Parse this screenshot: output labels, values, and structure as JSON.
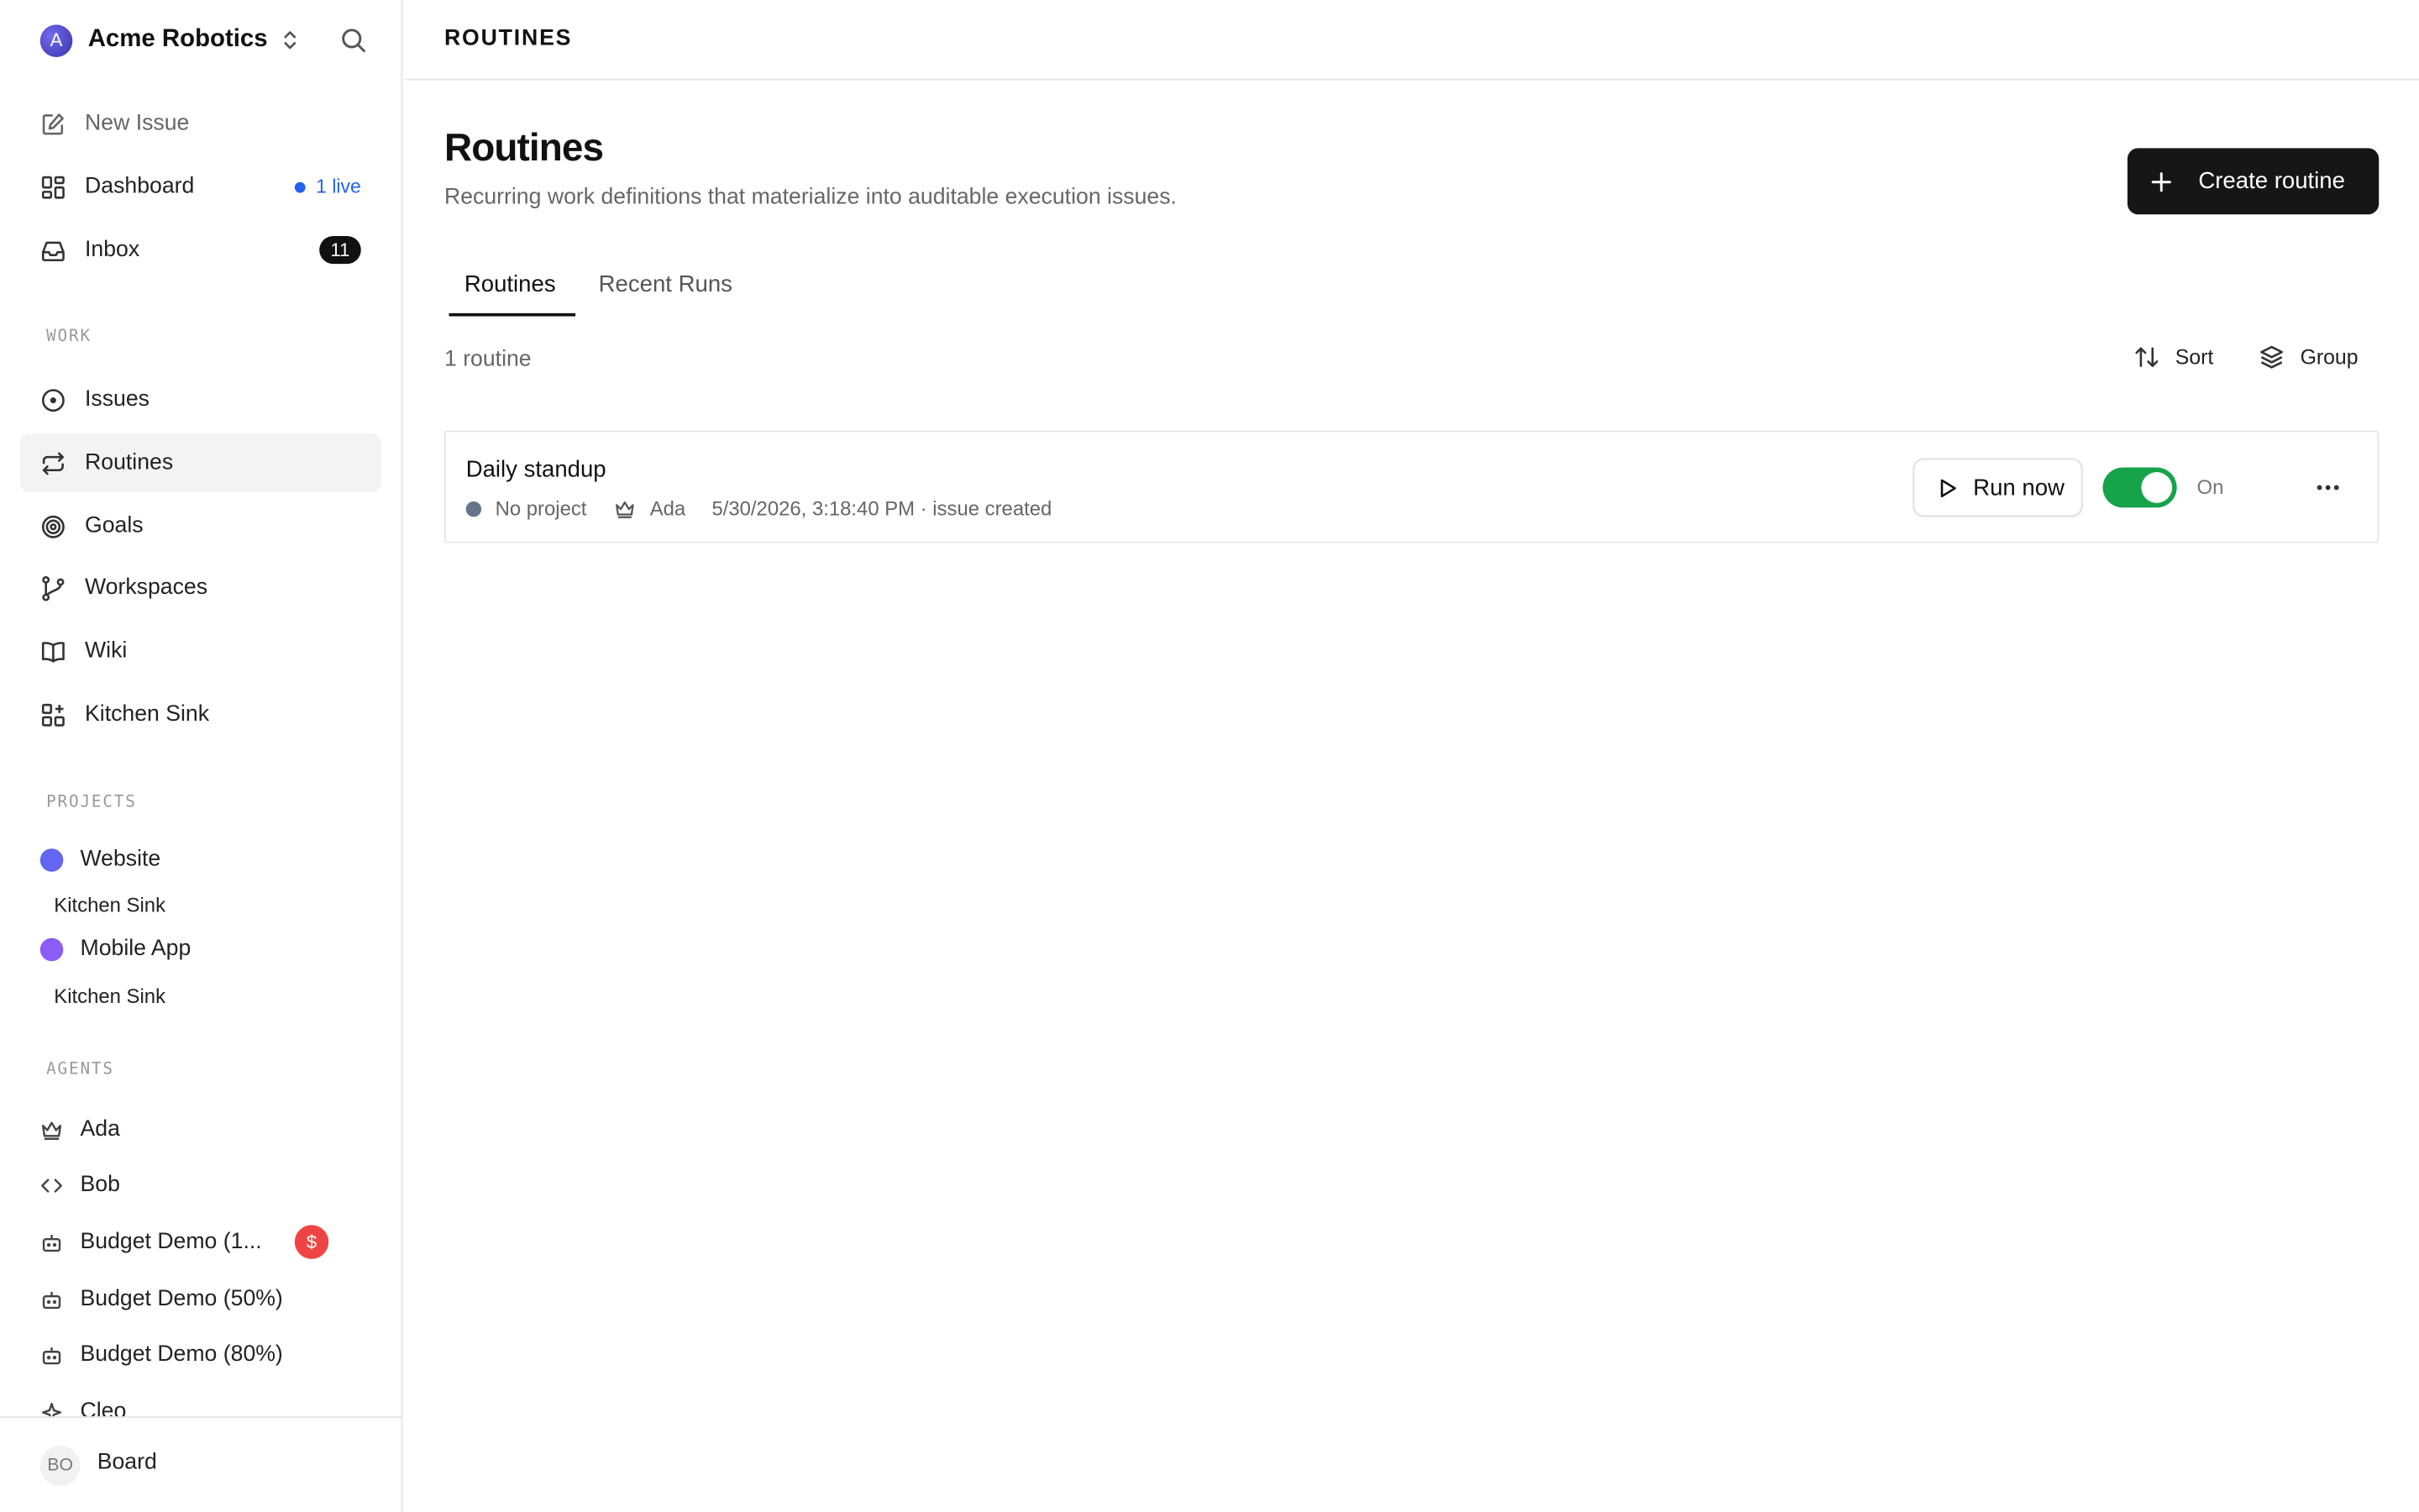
{
  "company": {
    "initial": "A",
    "name": "Acme Robotics"
  },
  "nav": {
    "new_issue": "New Issue",
    "dashboard": "Dashboard",
    "dashboard_live": "1 live",
    "inbox": "Inbox",
    "inbox_count": "11"
  },
  "sections": {
    "work": "WORK",
    "projects": "PROJECTS",
    "agents": "AGENTS"
  },
  "work_items": [
    "Issues",
    "Routines",
    "Goals",
    "Workspaces",
    "Wiki",
    "Kitchen Sink"
  ],
  "projects": [
    {
      "name": "Website",
      "color": "#6366f1",
      "sub": "Kitchen Sink"
    },
    {
      "name": "Mobile App",
      "color": "#8b5cf6",
      "sub": "Kitchen Sink"
    }
  ],
  "agents": [
    {
      "name": "Ada",
      "icon": "crown-icon"
    },
    {
      "name": "Bob",
      "icon": "code-icon"
    },
    {
      "name": "Budget Demo (1...",
      "icon": "bot-icon",
      "badge": "$"
    },
    {
      "name": "Budget Demo (50%)",
      "icon": "bot-icon"
    },
    {
      "name": "Budget Demo (80%)",
      "icon": "bot-icon"
    },
    {
      "name": "Cleo",
      "icon": "sparkle-icon"
    }
  ],
  "footer": {
    "initials": "BO",
    "name": "Board"
  },
  "header": {
    "breadcrumb": "ROUTINES"
  },
  "page": {
    "title": "Routines",
    "subtitle": "Recurring work definitions that materialize into auditable execution issues.",
    "create_label": "Create routine"
  },
  "tabs": [
    {
      "label": "Routines",
      "active": true
    },
    {
      "label": "Recent Runs",
      "active": false
    }
  ],
  "list": {
    "count": "1 routine",
    "sort_label": "Sort",
    "group_label": "Group"
  },
  "routines": [
    {
      "title": "Daily standup",
      "project": "No project",
      "assignee": "Ada",
      "last_run": "5/30/2026, 3:18:40 PM · issue created",
      "run_label": "Run now",
      "enabled": true,
      "toggle_label": "On"
    }
  ],
  "colors": {
    "accent": "#2563eb",
    "toggle_on": "#16a34a",
    "badge_red": "#ef4444",
    "primary_button": "#161616"
  }
}
